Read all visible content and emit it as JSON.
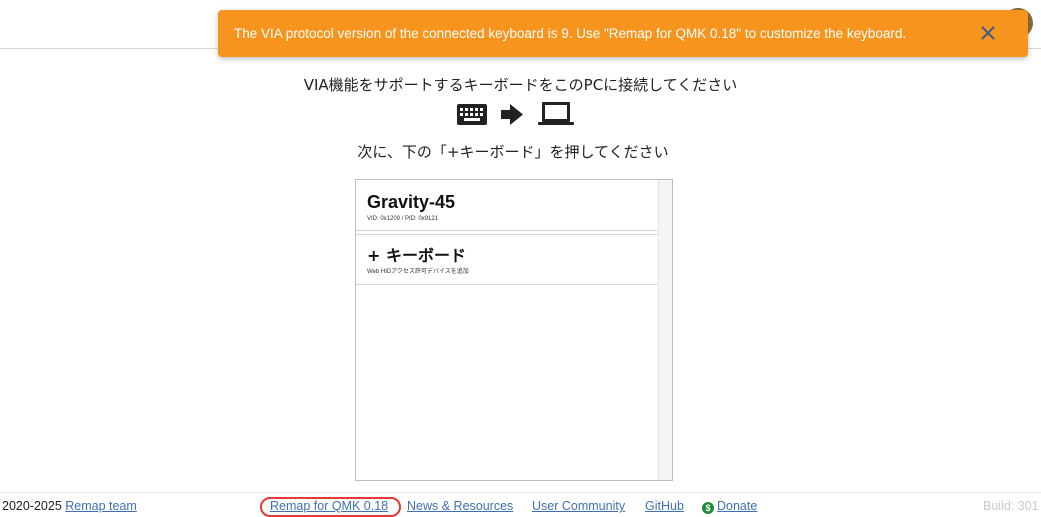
{
  "toast": {
    "message": "The VIA protocol version of the connected keyboard is 9. Use \"Remap for QMK 0.18\" to customize the keyboard.",
    "close_icon": "close-icon",
    "color": "#f7941d"
  },
  "instructions": {
    "line1": "VIA機能をサポートするキーボードをこのPCに接続してください",
    "line2": "次に、下の「+キーボード」を押してください",
    "icons": [
      "keyboard-icon",
      "arrow-right-icon",
      "laptop-icon"
    ]
  },
  "device_list": {
    "items": [
      {
        "title": "Gravity-45",
        "subtitle": "VID: 0x1209 / PID: 0x9121"
      },
      {
        "title": "+ キーボード",
        "subtitle": "Web HIDアクセス許可デバイスを追加"
      }
    ]
  },
  "footer": {
    "copyright": "2020-2025",
    "team_link": "Remap team",
    "remap_link": "Remap for QMK 0.18",
    "news_link": "News & Resources",
    "community_link": "User Community",
    "github_link": "GitHub",
    "donate_link": "Donate",
    "build": "Build: 301",
    "highlight_color": "#e53935"
  }
}
